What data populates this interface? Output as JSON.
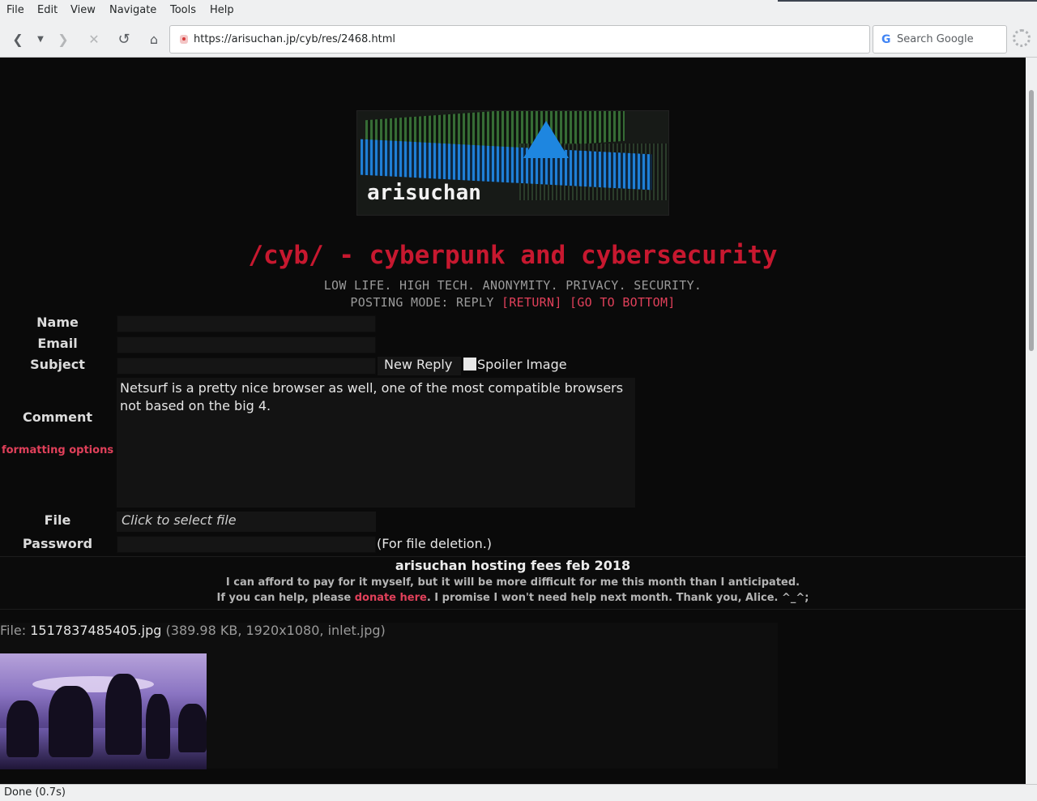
{
  "menu": [
    "File",
    "Edit",
    "View",
    "Navigate",
    "Tools",
    "Help"
  ],
  "address": {
    "url": "https://arisuchan.jp/cyb/res/2468.html"
  },
  "search": {
    "placeholder": "Search Google"
  },
  "banner": {
    "text": "arisuchan"
  },
  "board": {
    "title": "/cyb/ - cyberpunk and cybersecurity",
    "tagline": "LOW LIFE. HIGH TECH. ANONYMITY. PRIVACY. SECURITY.",
    "posting_mode": "POSTING MODE: REPLY",
    "return_link": "[RETURN]",
    "bottom_link": "[GO TO BOTTOM]"
  },
  "form": {
    "name_label": "Name",
    "email_label": "Email",
    "subject_label": "Subject",
    "submit_label": "New Reply",
    "spoiler_label": "Spoiler Image",
    "comment_label": "Comment",
    "comment_value": "Netsurf is a pretty nice browser as well, one of the most compatible browsers not based on the big 4.",
    "formatting_link": "formatting options",
    "file_label": "File",
    "file_button": "Click to select file",
    "password_label": "Password",
    "password_note": "(For file deletion.)"
  },
  "announcement": {
    "title": "arisuchan hosting fees feb 2018",
    "line1": "I can afford to pay for it myself, but it will be more difficult for me this month than I anticipated.",
    "line2_before": "If you can help, please ",
    "line2_link": "donate here",
    "line2_after": ". I promise I won't need help next month. Thank you, Alice. ^_^;"
  },
  "post": {
    "file_prefix": "File: ",
    "file_name": "1517837485405.jpg",
    "file_meta": "(389.98 KB, 1920x1080, inlet.jpg)"
  },
  "status": {
    "text": "Done (0.7s)"
  },
  "colors": {
    "accent": "#c7182f",
    "link": "#e0405a",
    "background": "#0a0a0a"
  }
}
